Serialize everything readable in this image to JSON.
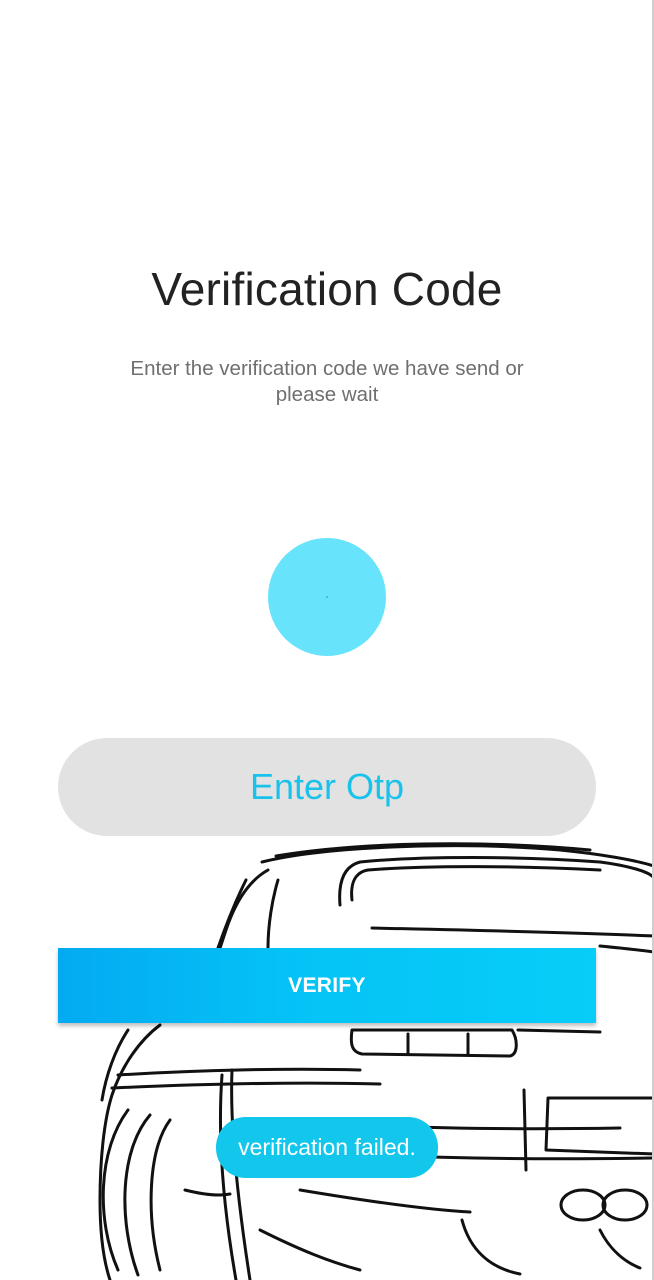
{
  "header": {
    "title": "Verification Code",
    "subtitle": "Enter the verification code we have send or please wait"
  },
  "otp": {
    "value": "",
    "placeholder": "Enter Otp"
  },
  "actions": {
    "verify_label": "VERIFY"
  },
  "toast": {
    "message": "verification failed."
  },
  "colors": {
    "accent": "#13c6ec",
    "progress": "#67e3fb",
    "input_background": "#e2e2e2",
    "title_text": "#222222",
    "subtitle_text": "#6f6f6f"
  },
  "illustration": {
    "icon": "car-rear-sketch"
  }
}
